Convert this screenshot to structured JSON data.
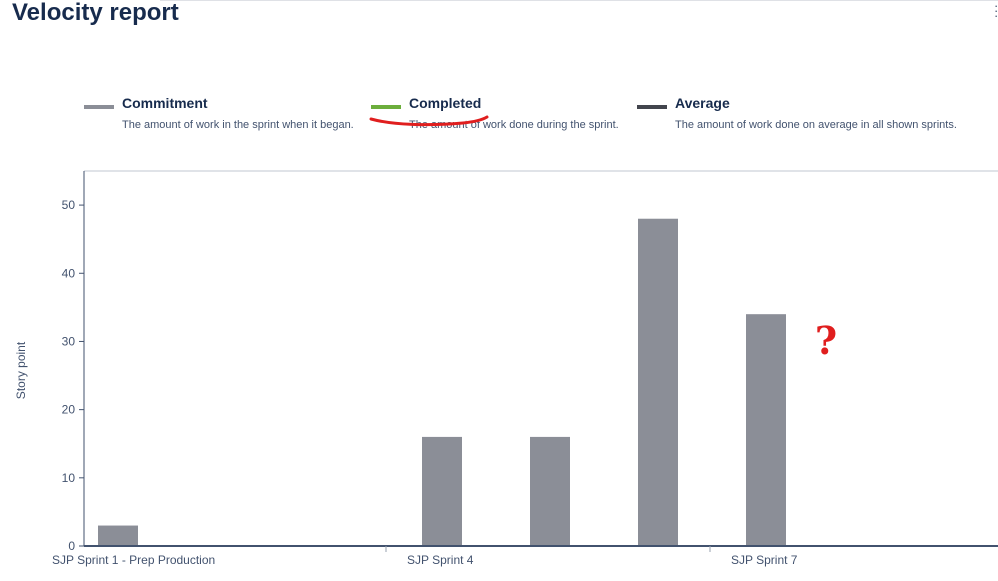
{
  "page": {
    "title": "Velocity report"
  },
  "legend": [
    {
      "name": "Commitment",
      "description": "The amount of work in the sprint when it began.",
      "color": "#8b8e97"
    },
    {
      "name": "Completed",
      "description": "The amount of work done during the sprint.",
      "color": "#6cae3c"
    },
    {
      "name": "Average",
      "description": "The amount of work done on average in all shown sprints.",
      "color": "#42454d"
    }
  ],
  "annotation": {
    "text": "?",
    "color": "#e01e1e"
  },
  "chart_data": {
    "type": "bar",
    "categories": [
      "",
      "",
      "",
      "",
      "",
      "",
      ""
    ],
    "x_tick_labels": [
      "SJP Sprint 1 - Prep Production",
      "SJP Sprint 4",
      "SJP Sprint 7"
    ],
    "series": [
      {
        "name": "Commitment",
        "values": [
          3,
          0,
          0,
          16,
          16,
          48,
          34
        ],
        "color": "#8b8e97"
      }
    ],
    "ylabel": "Story point",
    "yticks": [
      0,
      10,
      20,
      30,
      40,
      50
    ],
    "ylim": [
      0,
      55
    ],
    "grid": false
  }
}
